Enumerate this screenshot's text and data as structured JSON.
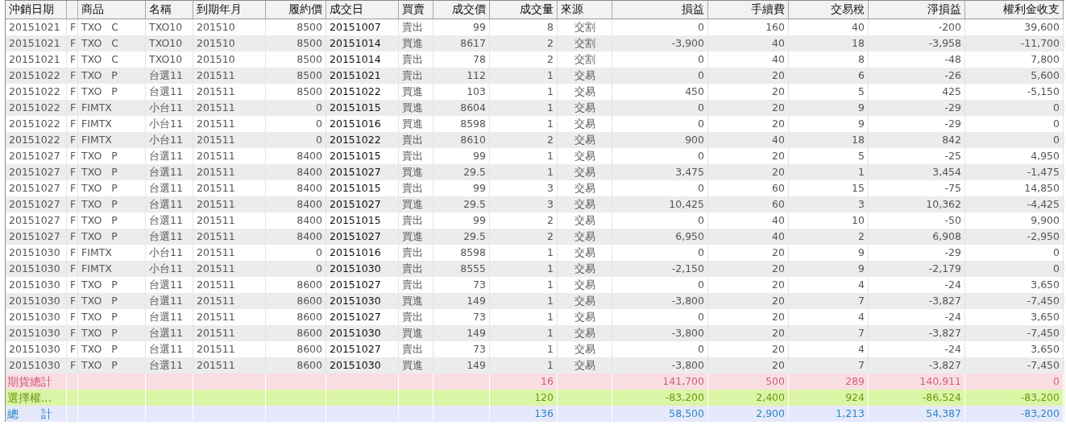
{
  "table": {
    "columns": [
      {
        "label": "沖銷日期"
      },
      {},
      {
        "label": "商品"
      },
      {
        "label": "名稱"
      },
      {
        "label": "到期年月"
      },
      {
        "label": "履約價"
      },
      {
        "label": "成交日"
      },
      {
        "label": "買賣"
      },
      {
        "label": "成交價"
      },
      {
        "label": "成交量"
      },
      {
        "label": "來源"
      },
      {
        "label": "損益"
      },
      {
        "label": "手續費"
      },
      {
        "label": "交易稅"
      },
      {
        "label": "淨損益"
      },
      {
        "label": "權利金收支"
      }
    ],
    "rows": [
      [
        "20151021",
        "F",
        "TXO   C",
        "TXO10",
        "201510",
        "8500",
        "20151007",
        "賣出",
        "99",
        "8",
        "交割",
        "0",
        "160",
        "40",
        "-200",
        "39,600"
      ],
      [
        "20151021",
        "F",
        "TXO   C",
        "TXO10",
        "201510",
        "8500",
        "20151014",
        "買進",
        "8617",
        "2",
        "交割",
        "-3,900",
        "40",
        "18",
        "-3,958",
        "-11,700"
      ],
      [
        "20151021",
        "F",
        "TXO   C",
        "TXO10",
        "201510",
        "8500",
        "20151014",
        "賣出",
        "78",
        "2",
        "交割",
        "0",
        "40",
        "8",
        "-48",
        "7,800"
      ],
      [
        "20151022",
        "F",
        "TXO   P",
        "台選11",
        "201511",
        "8500",
        "20151021",
        "賣出",
        "112",
        "1",
        "交易",
        "0",
        "20",
        "6",
        "-26",
        "5,600"
      ],
      [
        "20151022",
        "F",
        "TXO   P",
        "台選11",
        "201511",
        "8500",
        "20151022",
        "買進",
        "103",
        "1",
        "交易",
        "450",
        "20",
        "5",
        "425",
        "-5,150"
      ],
      [
        "20151022",
        "F",
        "FIMTX",
        "小台11",
        "201511",
        "0",
        "20151015",
        "買進",
        "8604",
        "1",
        "交易",
        "0",
        "20",
        "9",
        "-29",
        "0"
      ],
      [
        "20151022",
        "F",
        "FIMTX",
        "小台11",
        "201511",
        "0",
        "20151016",
        "買進",
        "8598",
        "1",
        "交易",
        "0",
        "20",
        "9",
        "-29",
        "0"
      ],
      [
        "20151022",
        "F",
        "FIMTX",
        "小台11",
        "201511",
        "0",
        "20151022",
        "賣出",
        "8610",
        "2",
        "交易",
        "900",
        "40",
        "18",
        "842",
        "0"
      ],
      [
        "20151027",
        "F",
        "TXO   P",
        "台選11",
        "201511",
        "8400",
        "20151015",
        "賣出",
        "99",
        "1",
        "交易",
        "0",
        "20",
        "5",
        "-25",
        "4,950"
      ],
      [
        "20151027",
        "F",
        "TXO   P",
        "台選11",
        "201511",
        "8400",
        "20151027",
        "買進",
        "29.5",
        "1",
        "交易",
        "3,475",
        "20",
        "1",
        "3,454",
        "-1,475"
      ],
      [
        "20151027",
        "F",
        "TXO   P",
        "台選11",
        "201511",
        "8400",
        "20151015",
        "賣出",
        "99",
        "3",
        "交易",
        "0",
        "60",
        "15",
        "-75",
        "14,850"
      ],
      [
        "20151027",
        "F",
        "TXO   P",
        "台選11",
        "201511",
        "8400",
        "20151027",
        "買進",
        "29.5",
        "3",
        "交易",
        "10,425",
        "60",
        "3",
        "10,362",
        "-4,425"
      ],
      [
        "20151027",
        "F",
        "TXO   P",
        "台選11",
        "201511",
        "8400",
        "20151015",
        "賣出",
        "99",
        "2",
        "交易",
        "0",
        "40",
        "10",
        "-50",
        "9,900"
      ],
      [
        "20151027",
        "F",
        "TXO   P",
        "台選11",
        "201511",
        "8400",
        "20151027",
        "買進",
        "29.5",
        "2",
        "交易",
        "6,950",
        "40",
        "2",
        "6,908",
        "-2,950"
      ],
      [
        "20151030",
        "F",
        "FIMTX",
        "小台11",
        "201511",
        "0",
        "20151016",
        "賣出",
        "8598",
        "1",
        "交易",
        "0",
        "20",
        "9",
        "-29",
        "0"
      ],
      [
        "20151030",
        "F",
        "FIMTX",
        "小台11",
        "201511",
        "0",
        "20151030",
        "賣出",
        "8555",
        "1",
        "交易",
        "-2,150",
        "20",
        "9",
        "-2,179",
        "0"
      ],
      [
        "20151030",
        "F",
        "TXO   P",
        "台選11",
        "201511",
        "8600",
        "20151027",
        "賣出",
        "73",
        "1",
        "交易",
        "0",
        "20",
        "4",
        "-24",
        "3,650"
      ],
      [
        "20151030",
        "F",
        "TXO   P",
        "台選11",
        "201511",
        "8600",
        "20151030",
        "買進",
        "149",
        "1",
        "交易",
        "-3,800",
        "20",
        "7",
        "-3,827",
        "-7,450"
      ],
      [
        "20151030",
        "F",
        "TXO   P",
        "台選11",
        "201511",
        "8600",
        "20151027",
        "賣出",
        "73",
        "1",
        "交易",
        "0",
        "20",
        "4",
        "-24",
        "3,650"
      ],
      [
        "20151030",
        "F",
        "TXO   P",
        "台選11",
        "201511",
        "8600",
        "20151030",
        "買進",
        "149",
        "1",
        "交易",
        "-3,800",
        "20",
        "7",
        "-3,827",
        "-7,450"
      ],
      [
        "20151030",
        "F",
        "TXO   P",
        "台選11",
        "201511",
        "8600",
        "20151027",
        "賣出",
        "73",
        "1",
        "交易",
        "0",
        "20",
        "4",
        "-24",
        "3,650"
      ],
      [
        "20151030",
        "F",
        "TXO   P",
        "台選11",
        "201511",
        "8600",
        "20151030",
        "買進",
        "149",
        "1",
        "交易",
        "-3,800",
        "20",
        "7",
        "-3,827",
        "-7,450"
      ]
    ],
    "totals": [
      {
        "kind": "futures",
        "label": "期貨總計",
        "quantity": "16",
        "profit_loss": "141,700",
        "fee": "500",
        "tax": "289",
        "net_profit_loss": "140,911",
        "premium": "0"
      },
      {
        "kind": "options",
        "label": "選擇權...",
        "quantity": "120",
        "profit_loss": "-83,200",
        "fee": "2,400",
        "tax": "924",
        "net_profit_loss": "-86,524",
        "premium": "-83,200"
      },
      {
        "kind": "total",
        "label": "總　　計",
        "quantity": "136",
        "profit_loss": "58,500",
        "fee": "2,900",
        "tax": "1,213",
        "net_profit_loss": "54,387",
        "premium": "-83,200"
      }
    ]
  }
}
